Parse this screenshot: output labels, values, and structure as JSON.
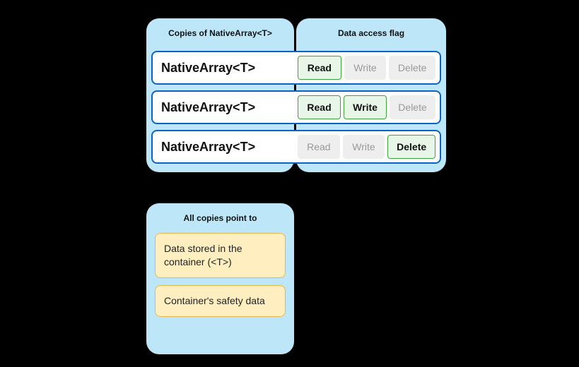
{
  "panels": {
    "copies": {
      "title": "Copies of NativeArray<T>"
    },
    "flags": {
      "title": "Data access flag"
    },
    "point": {
      "title": "All copies point to"
    }
  },
  "rows": [
    {
      "label": "NativeArray<T>",
      "flags": {
        "read": "Read",
        "write": "Write",
        "delete": "Delete"
      },
      "active": {
        "read": true,
        "write": false,
        "delete": false
      }
    },
    {
      "label": "NativeArray<T>",
      "flags": {
        "read": "Read",
        "write": "Write",
        "delete": "Delete"
      },
      "active": {
        "read": true,
        "write": true,
        "delete": false
      }
    },
    {
      "label": "NativeArray<T>",
      "flags": {
        "read": "Read",
        "write": "Write",
        "delete": "Delete"
      },
      "active": {
        "read": false,
        "write": false,
        "delete": true
      }
    }
  ],
  "point_items": [
    "Data stored in the container (<T>)",
    "Container's safety data"
  ]
}
